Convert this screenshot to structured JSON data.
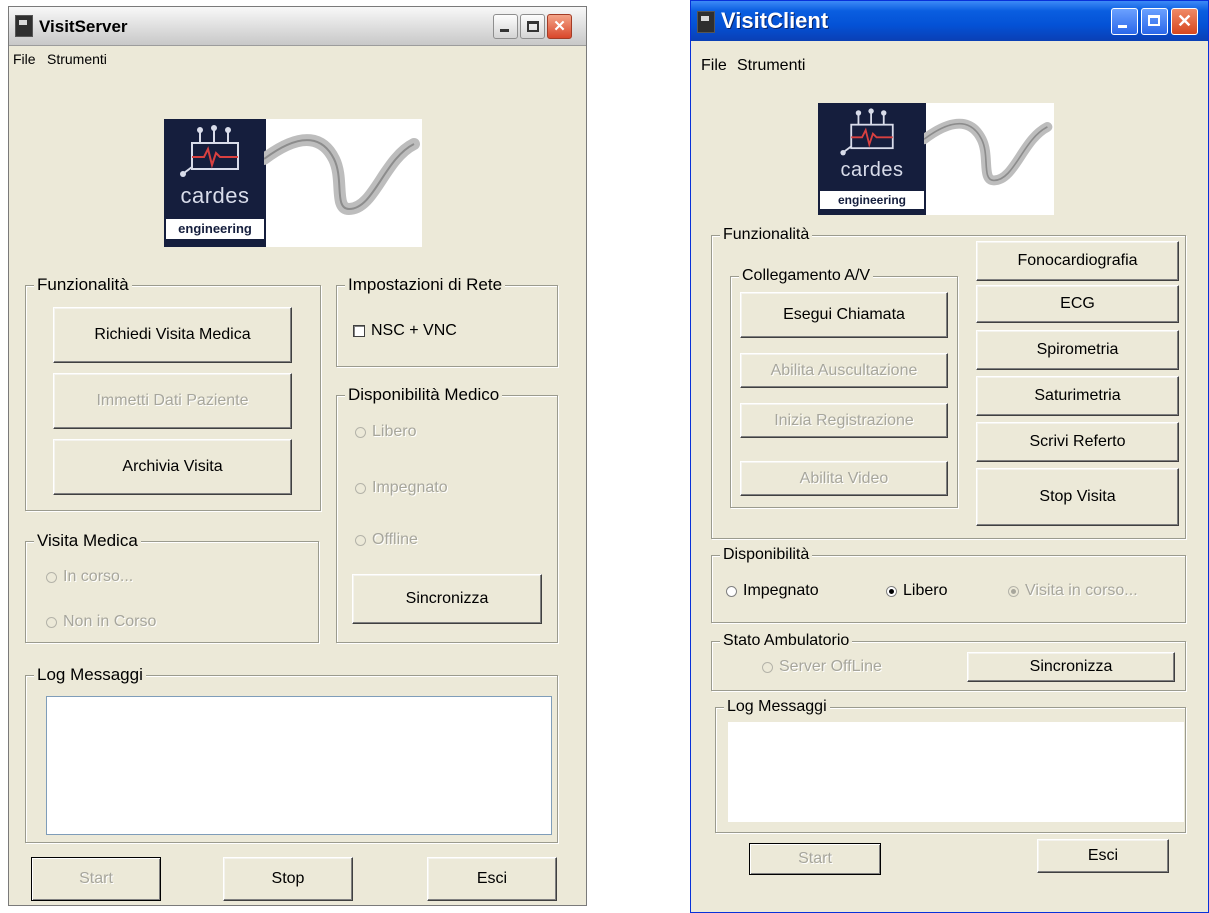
{
  "server": {
    "title": "VisitServer",
    "menu": [
      "File",
      "Strumenti"
    ],
    "logo": {
      "word": "cardes",
      "sub": "engineering"
    },
    "funzionalita": {
      "label": "Funzionalità",
      "buttons": [
        "Richiedi Visita Medica",
        "Immetti Dati Paziente",
        "Archivia Visita"
      ]
    },
    "rete": {
      "label": "Impostazioni di Rete",
      "checkbox": "NSC + VNC"
    },
    "disponibilita": {
      "label": "Disponibilità Medico",
      "options": [
        "Libero",
        "Impegnato",
        "Offline"
      ],
      "sync": "Sincronizza"
    },
    "visita": {
      "label": "Visita Medica",
      "options": [
        "In corso...",
        "Non in Corso"
      ]
    },
    "log": {
      "label": "Log Messaggi"
    },
    "footer": {
      "start": "Start",
      "stop": "Stop",
      "exit": "Esci"
    }
  },
  "client": {
    "title": "VisitClient",
    "menu": [
      "File",
      "Strumenti"
    ],
    "logo": {
      "word": "cardes",
      "sub": "engineering"
    },
    "funzionalita": {
      "label": "Funzionalità",
      "av": {
        "label": "Collegamento A/V",
        "buttons": [
          "Esegui Chiamata",
          "Abilita Auscultazione",
          "Inizia Registrazione",
          "Abilita Video"
        ]
      },
      "right_buttons": [
        "Fonocardiografia",
        "ECG",
        "Spirometria",
        "Saturimetria",
        "Scrivi Referto",
        "Stop Visita"
      ]
    },
    "disponibilita": {
      "label": "Disponibilità",
      "options": [
        "Impegnato",
        "Libero",
        "Visita in corso..."
      ]
    },
    "stato": {
      "label": "Stato Ambulatorio",
      "option": "Server OffLine",
      "sync": "Sincronizza"
    },
    "log": {
      "label": "Log Messaggi"
    },
    "footer": {
      "start": "Start",
      "exit": "Esci"
    }
  },
  "colors": {
    "window_bg": "#ece9d8",
    "xp_blue": "#0452d6",
    "close_red": "#d9472b",
    "logo_navy": "#151e3d"
  }
}
